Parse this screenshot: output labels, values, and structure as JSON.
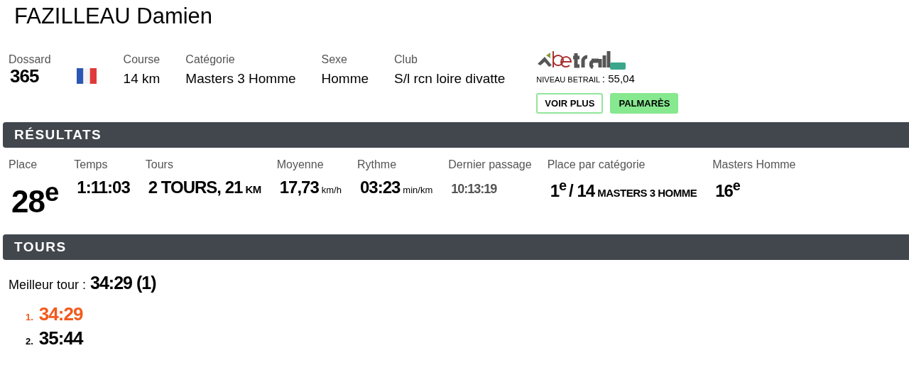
{
  "athlete": {
    "name": "FAZILLEAU Damien"
  },
  "info": [
    {
      "kind": "big",
      "label": "Dossard",
      "value": "365"
    },
    {
      "kind": "flag"
    },
    {
      "kind": "text",
      "label": "Course",
      "value": "14 km"
    },
    {
      "kind": "text",
      "label": "Catégorie",
      "value": "Masters 3 Homme"
    },
    {
      "kind": "text",
      "label": "Sexe",
      "value": "Homme"
    },
    {
      "kind": "text",
      "label": "Club",
      "value": "S/l rcn loire divatte"
    }
  ],
  "betrail": {
    "level_label": "NIVEAU BETRAIL",
    "level_value": ": 55,04",
    "buttons": [
      {
        "label": "VOIR PLUS",
        "kind": "outline"
      },
      {
        "label": "PALMARÈS",
        "kind": "filled"
      }
    ]
  },
  "results": {
    "title": "RÉSULTATS",
    "stats": [
      {
        "kind": "huge",
        "label": "Place",
        "value": "28$^{e}$"
      },
      {
        "kind": "big",
        "label": "Temps",
        "value": "1:11:03"
      },
      {
        "kind": "unit",
        "label": "Tours",
        "value": "2 TOURS, 21",
        "unit": "KM"
      },
      {
        "kind": "unit_small",
        "label": "Moyenne",
        "value": "17,73",
        "unit": "km/h"
      },
      {
        "kind": "unit_small",
        "label": "Rythme",
        "value": "03:23",
        "unit": "min/km"
      },
      {
        "kind": "muted",
        "label": "Dernier passage",
        "value": "10:13:19"
      },
      {
        "kind": "category",
        "label": "Place par catégorie",
        "value": "1$^{e}$",
        "total": "/ 14",
        "unit": "MASTERS 3 HOMME"
      },
      {
        "kind": "big",
        "label": "Masters Homme",
        "value": "16$^{e}$"
      }
    ]
  },
  "tours": {
    "title": "TOURS",
    "best_label": "Meilleur tour :",
    "best_value": "34:29 (1)",
    "laps": [
      {
        "number": "1.",
        "time": "34:29",
        "best": true
      },
      {
        "number": "2.",
        "time": "35:44",
        "best": false
      }
    ]
  }
}
